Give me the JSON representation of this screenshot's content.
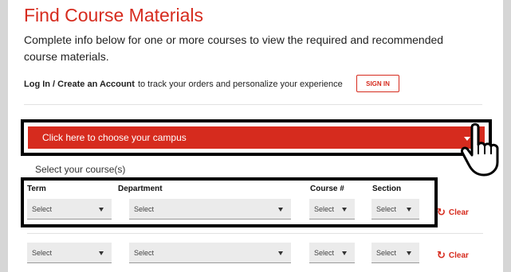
{
  "header": {
    "title": "Find Course Materials",
    "intro": "Complete info below for one or more courses to view the required and recommended course materials."
  },
  "account": {
    "link_label": "Log In / Create an Account",
    "suffix": "to track your orders and personalize your experience",
    "signin_label": "SIGN IN"
  },
  "campus": {
    "label": "Click here to choose your campus"
  },
  "courses": {
    "section_label": "Select your course(s)",
    "columns": {
      "term": "Term",
      "department": "Department",
      "course": "Course #",
      "section": "Section"
    },
    "rows": [
      {
        "term": "Select",
        "department": "Select",
        "course": "Select",
        "section": "Select",
        "clear": "Clear"
      },
      {
        "term": "Select",
        "department": "Select",
        "course": "Select",
        "section": "Select",
        "clear": "Clear"
      }
    ]
  },
  "colors": {
    "accent": "#d62b1e",
    "highlight_border": "#000000"
  },
  "icons": {
    "pointer": "hand-pointer-icon",
    "clear": "refresh-icon",
    "dropdown": "caret-down-icon"
  }
}
